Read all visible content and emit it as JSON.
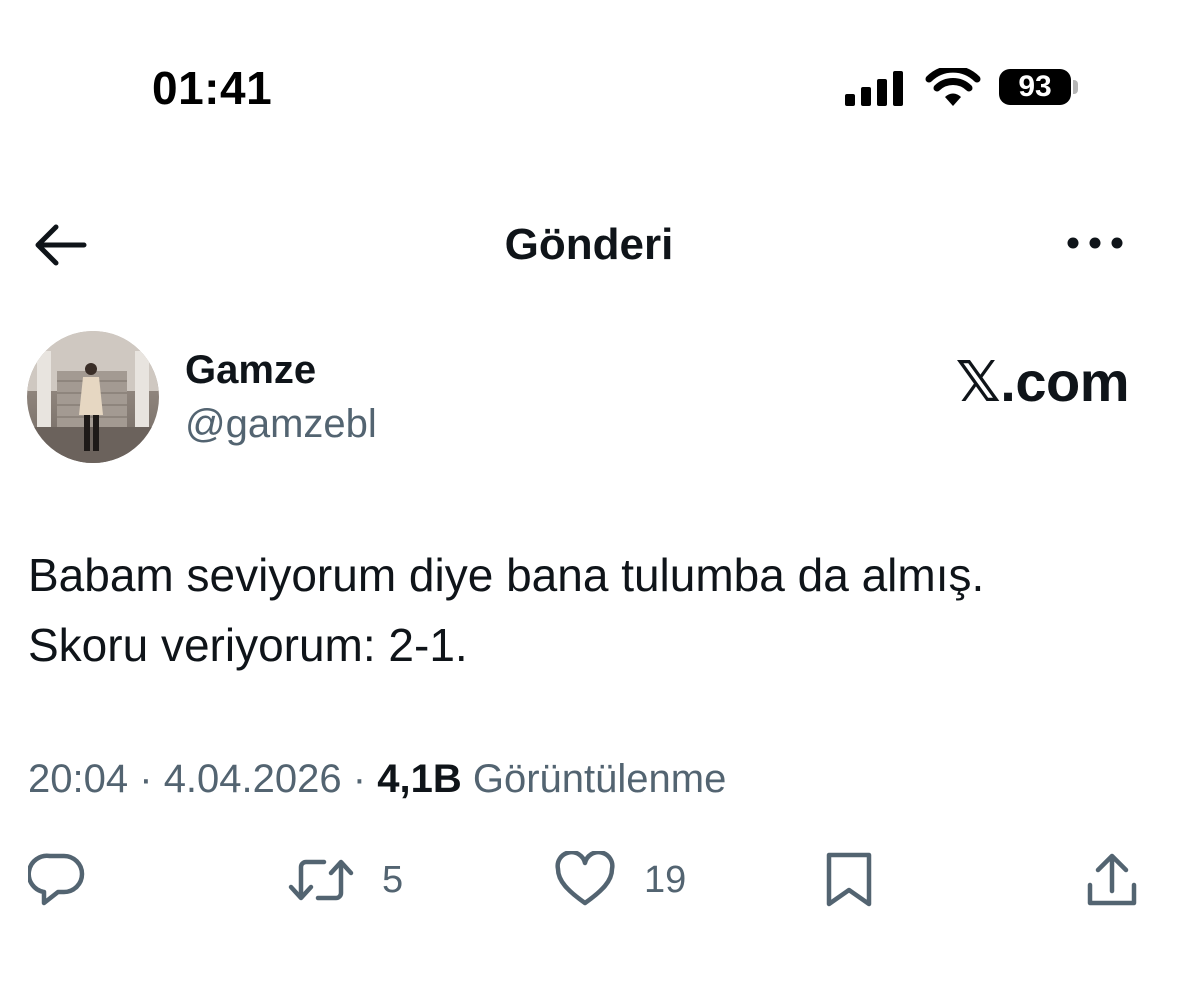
{
  "status_bar": {
    "time": "01:41",
    "battery": "93",
    "icons": [
      "cellular-signal-icon",
      "wifi-icon",
      "battery-icon"
    ]
  },
  "header": {
    "title": "Gönderi",
    "back_icon": "back-arrow-icon",
    "more_icon": "more-options-icon"
  },
  "post": {
    "author": {
      "name": "Gamze",
      "handle": "@gamzebl"
    },
    "brand": "𝕏.com",
    "text_lines": [
      "Babam seviyorum diye bana tulumba da almış.",
      "Skoru veriyorum: 2-1."
    ],
    "meta": {
      "time": "20:04",
      "separator": "·",
      "date": "4.04.2026",
      "views_count": "4,1B",
      "views_label": "Görüntülenme"
    },
    "actions": {
      "reply": {
        "icon": "reply-icon",
        "count": ""
      },
      "repost": {
        "icon": "repost-icon",
        "count": "5"
      },
      "like": {
        "icon": "heart-icon",
        "count": "19"
      },
      "bookmark": {
        "icon": "bookmark-icon"
      },
      "share": {
        "icon": "share-icon"
      }
    }
  },
  "colors": {
    "primary_text": "#0f1419",
    "secondary_text": "#536471",
    "background": "#ffffff"
  }
}
